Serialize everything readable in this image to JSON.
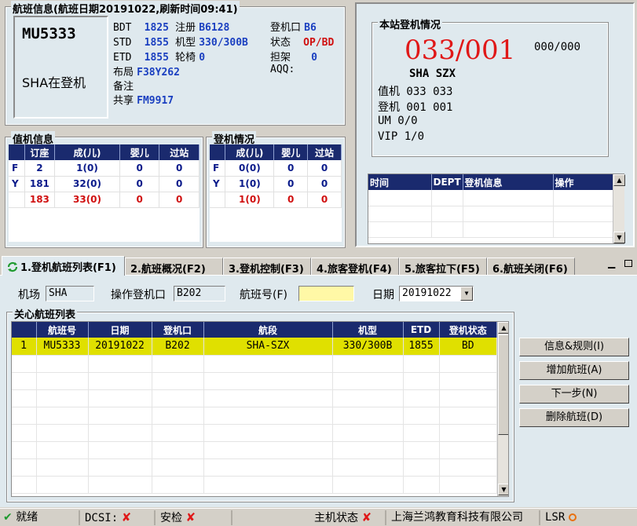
{
  "flight_info": {
    "title": "航班信息(航班日期20191022,刷新时间09:41)",
    "flight_number": "MU5333",
    "status_line": "SHA在登机",
    "bdt_label": "BDT",
    "bdt": "1825",
    "reg_label": "注册",
    "reg": "B6128",
    "std_label": "STD",
    "std": "1855",
    "model_label": "机型",
    "model": "330/300B",
    "etd_label": "ETD",
    "etd": "1855",
    "wheelchair_label": "轮椅",
    "wheelchair": "0",
    "layout_label": "布局",
    "layout": "F38Y262",
    "remark_label": "备注",
    "share_label": "共享",
    "share": "FM9917",
    "gate_label": "登机口",
    "gate": "B6",
    "state_label": "状态",
    "state": "OP/BD",
    "stretcher_label": "担架",
    "stretcher": "0",
    "aqq_label": "AQQ:"
  },
  "checkin_info": {
    "title": "值机信息",
    "headers": [
      "",
      "订座",
      "成(儿)",
      "婴儿",
      "过站"
    ],
    "rows": [
      [
        "F",
        "2",
        "1(0)",
        "0",
        "0"
      ],
      [
        "Y",
        "181",
        "32(0)",
        "0",
        "0"
      ],
      [
        "",
        "183",
        "33(0)",
        "0",
        "0"
      ]
    ]
  },
  "boarding_info": {
    "title": "登机情况",
    "headers": [
      "",
      "成(儿)",
      "婴儿",
      "过站"
    ],
    "rows": [
      [
        "F",
        "0(0)",
        "0",
        "0"
      ],
      [
        "Y",
        "1(0)",
        "0",
        "0"
      ],
      [
        "",
        "1(0)",
        "0",
        "0"
      ]
    ]
  },
  "station": {
    "title": "本站登机情况",
    "big": "033/001",
    "small": "000/000",
    "route": "SHA  SZX",
    "checkin_line": "值机 033  033",
    "boarded_line": "登机 001  001",
    "um_line": "UM  0/0",
    "vip_line": "VIP 1/0",
    "log_headers": [
      "时间",
      "DEPT",
      "登机信息",
      "操作"
    ]
  },
  "tabs": [
    "1.登机航班列表(F1)",
    "2.航班概况(F2)",
    "3.登机控制(F3)",
    "4.旅客登机(F4)",
    "5.旅客拉下(F5)",
    "6.航班关闭(F6)"
  ],
  "filters": {
    "airport_label": "机场",
    "airport": "SHA",
    "gate_label": "操作登机口",
    "gate": "B202",
    "flight_label": "航班号(F)",
    "flight": "",
    "date_label": "日期",
    "date": "20191022"
  },
  "watch_list": {
    "title": "关心航班列表",
    "headers": [
      "",
      "航班号",
      "日期",
      "登机口",
      "航段",
      "机型",
      "ETD",
      "登机状态"
    ],
    "rows": [
      [
        "1",
        "MU5333",
        "20191022",
        "B202",
        "SHA-SZX",
        "330/300B",
        "1855",
        "BD"
      ]
    ]
  },
  "buttons": {
    "info": "信息&规则(I)",
    "add": "增加航班(A)",
    "next": "下一步(N)",
    "delete": "删除航班(D)"
  },
  "status_bar": {
    "ready": "就绪",
    "dcsi": "DCSI:",
    "security": "安检",
    "host": "主机状态",
    "company": "上海兰鸿教育科技有限公司",
    "lsr": "LSR"
  },
  "colors": {
    "header_blue": "#1a2a6e",
    "panel_bg": "#dfe9ee",
    "highlight_yellow": "#e0e000",
    "alert_red": "#e01818"
  }
}
